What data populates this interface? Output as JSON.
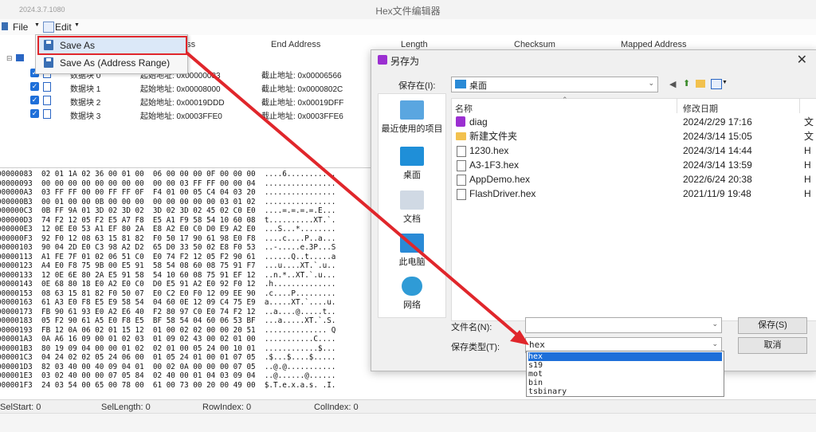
{
  "app": {
    "version": "2024.3.7.1080",
    "title": "Hex文件编辑器"
  },
  "menubar": {
    "file": "File",
    "edit": "Edit"
  },
  "edit_menu": {
    "save_as": "Save As",
    "save_as_range": "Save As (Address Range)"
  },
  "columns": {
    "start_partial": "ess",
    "end": "End Address",
    "length": "Length",
    "checksum": "Checksum",
    "mapped": "Mapped Address"
  },
  "tree": {
    "rows": [
      {
        "name": "数据块 0",
        "start": "起始地址: 0x00000083",
        "end": "截止地址: 0x00006566"
      },
      {
        "name": "数据块 1",
        "start": "起始地址: 0x00008000",
        "end": "截止地址: 0x0000802C"
      },
      {
        "name": "数据块 2",
        "start": "起始地址: 0x00019DDD",
        "end": "截止地址: 0x00019DFF"
      },
      {
        "name": "数据块 3",
        "start": "起始地址: 0x0003FFE0",
        "end": "截止地址: 0x0003FFE6"
      }
    ]
  },
  "hex": {
    "lines": [
      "00000083  02 01 1A 02 36 00 01 00  06 00 00 00 0F 00 00 00  ....6...........",
      "00000093  00 00 00 00 00 00 00 00  00 00 03 FF FF 00 00 04  ................",
      "000000A3  03 FF FF 00 00 FF FF 0F  F4 01 00 05 C4 04 03 20  ................",
      "000000B3  00 01 00 00 0B 00 00 00  00 00 00 00 00 03 01 02  ................",
      "000000C3  0B FF 9A 01 3D 02 3D 02  3D 02 3D 02 45 02 C0 E0  ....=.=.=.=.E...",
      "000000D3  74 F2 12 05 F2 E5 A7 F8  E5 A1 F9 58 54 10 60 08  t..........XT.`.",
      "000000E3  12 0E E0 53 A1 EF 80 2A  E8 A2 E0 C0 D0 E9 A2 E0  ...S...*........",
      "000000F3  92 F0 12 08 63 15 81 82  F0 50 17 90 61 98 E0 F8  ....c....P..a...",
      "00000103  90 04 2D E0 C3 98 A2 D2  65 D0 33 50 02 E8 F0 53  ..-.....e.3P...S",
      "00000113  A1 FE 7F 01 02 06 51 C0  E0 74 F2 12 05 F2 90 61  ......Q..t.....a",
      "00000123  A4 E0 F8 75 9B 00 E5 91  58 54 08 60 08 75 91 F7  ...u....XT.`.u..",
      "00000133  12 0E 6E 80 2A E5 91 58  54 10 60 08 75 91 EF 12  ..n.*..XT.`.u...",
      "00000143  0E 68 80 18 E0 A2 E0 C0  D0 E5 91 A2 E0 92 F0 12  .h..............",
      "00000153  08 63 15 81 82 F0 50 07  E0 C2 E0 F0 12 09 EE 90  .c....P.........",
      "00000163  61 A3 E0 F8 E5 E9 58 54  04 60 0E 12 09 C4 75 E9  a.....XT.`....u.",
      "00000173  FB 90 61 93 E0 A2 E6 40  F2 80 97 C0 E0 74 F2 12  ..a....@.....t..",
      "00000183  05 F2 90 61 A5 E0 F8 E5  BF 58 54 04 60 06 53 BF  ...a.....XT.`.S.",
      "00000193  FB 12 0A 06 02 01 15 12  01 00 02 02 00 00 20 51  .............. Q",
      "000001A3  0A A6 16 09 00 01 02 03  01 09 02 43 00 02 01 00  ...........C....",
      "000001B3  80 19 09 04 00 00 01 02  02 01 00 05 24 00 10 01  ............$...",
      "000001C3  04 24 02 02 05 24 06 00  01 05 24 01 00 01 07 05  .$...$....$.....",
      "000001D3  82 03 40 00 40 09 04 01  00 02 0A 00 00 00 07 05  ..@.@...........",
      "000001E3  03 02 40 00 00 07 05 84  02 40 00 01 04 03 09 04  ..@......@......",
      "000001F3  24 03 54 00 65 00 78 00  61 00 73 00 20 00 49 00  $.T.e.x.a.s. .I."
    ]
  },
  "status": {
    "sel_start": "SelStart: 0",
    "sel_length": "SelLength: 0",
    "row_index": "RowIndex: 0",
    "col_index": "ColIndex: 0"
  },
  "dialog": {
    "title": "另存为",
    "close": "✕",
    "save_in_label": "保存在(I):",
    "save_in_value": "桌面",
    "places": [
      "最近使用的项目",
      "桌面",
      "文档",
      "此电脑",
      "网络"
    ],
    "headers": {
      "name": "名称",
      "date": "修改日期"
    },
    "files": [
      {
        "name": "diag",
        "date": "2024/2/29 17:16",
        "type": "文",
        "kind": "app"
      },
      {
        "name": "新建文件夹",
        "date": "2024/3/14 15:05",
        "type": "文",
        "kind": "folder"
      },
      {
        "name": "1230.hex",
        "date": "2024/3/14 14:44",
        "type": "H",
        "kind": "file"
      },
      {
        "name": "A3-1F3.hex",
        "date": "2024/3/14 13:59",
        "type": "H",
        "kind": "file"
      },
      {
        "name": "AppDemo.hex",
        "date": "2022/6/24 20:38",
        "type": "H",
        "kind": "file"
      },
      {
        "name": "FlashDriver.hex",
        "date": "2021/11/9 19:48",
        "type": "H",
        "kind": "file"
      }
    ],
    "filename_label": "文件名(N):",
    "filename_value": "",
    "filetype_label": "保存类型(T):",
    "filetype_value": "hex",
    "save_button": "保存(S)",
    "cancel_button": "取消",
    "type_options": [
      "hex",
      "s19",
      "mot",
      "bin",
      "tsbinary"
    ]
  },
  "colors": {
    "highlight": "#e0262b",
    "selection": "#1e6fd9"
  }
}
